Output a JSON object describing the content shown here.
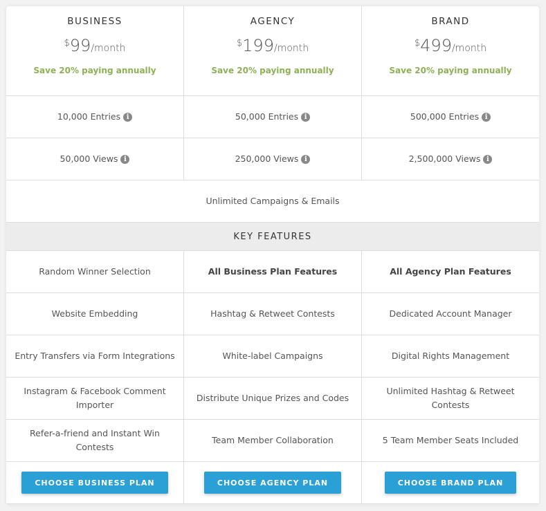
{
  "plans": [
    {
      "name": "BUSINESS",
      "currency": "$",
      "price": "99",
      "period": "/month",
      "save": "Save 20% paying annually",
      "entries": "10,000 Entries",
      "views": "50,000 Views",
      "button": "CHOOSE BUSINESS PLAN"
    },
    {
      "name": "AGENCY",
      "currency": "$",
      "price": "199",
      "period": "/month",
      "save": "Save 20% paying annually",
      "entries": "50,000 Entries",
      "views": "250,000 Views",
      "button": "CHOOSE AGENCY PLAN"
    },
    {
      "name": "BRAND",
      "currency": "$",
      "price": "499",
      "period": "/month",
      "save": "Save 20% paying annually",
      "entries": "500,000 Entries",
      "views": "2,500,000 Views",
      "button": "CHOOSE BRAND PLAN"
    }
  ],
  "info_icon": "i",
  "shared_feature": "Unlimited Campaigns & Emails",
  "section_title": "KEY FEATURES",
  "features": [
    [
      "Random Winner Selection",
      "All Business Plan Features",
      "All Agency Plan Features"
    ],
    [
      "Website Embedding",
      "Hashtag & Retweet Contests",
      "Dedicated Account Manager"
    ],
    [
      "Entry Transfers via Form Integrations",
      "White-label Campaigns",
      "Digital Rights Management"
    ],
    [
      "Instagram & Facebook Comment Importer",
      "Distribute Unique Prizes and Codes",
      "Unlimited Hashtag & Retweet Contests"
    ],
    [
      "Refer-a-friend and Instant Win Contests",
      "Team Member Collaboration",
      "5 Team Member Seats Included"
    ]
  ],
  "colors": {
    "accent": "#2aa0d6",
    "save": "#8db255"
  }
}
